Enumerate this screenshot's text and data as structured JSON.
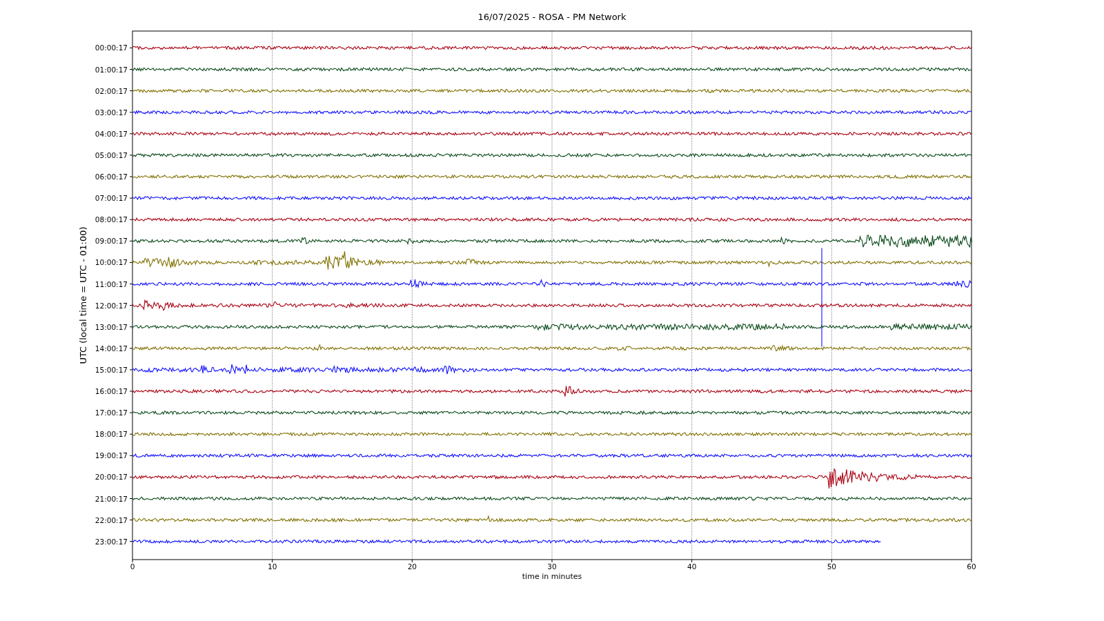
{
  "title": "16/07/2025 - ROSA - PM Network",
  "ylabel": "UTC (local time = UTC - 01:00)",
  "xlabel": "time in minutes",
  "xticks": [
    "0",
    "10",
    "20",
    "30",
    "40",
    "50",
    "60"
  ],
  "traces": [
    {
      "label": "00:00:17",
      "color": "#aa0011",
      "level": 1
    },
    {
      "label": "01:00:17",
      "color": "#0a4a1a",
      "level": 1
    },
    {
      "label": "02:00:17",
      "color": "#807000",
      "level": 1
    },
    {
      "label": "03:00:17",
      "color": "#1010ff",
      "level": 1
    },
    {
      "label": "04:00:17",
      "color": "#aa0011",
      "level": 1
    },
    {
      "label": "05:00:17",
      "color": "#0a4a1a",
      "level": 1
    },
    {
      "label": "06:00:17",
      "color": "#807000",
      "level": 1
    },
    {
      "label": "07:00:17",
      "color": "#1010ff",
      "level": 1
    },
    {
      "label": "08:00:17",
      "color": "#aa0011",
      "level": 1
    },
    {
      "label": "09:00:17",
      "color": "#0a4a1a",
      "level": 1
    },
    {
      "label": "10:00:17",
      "color": "#807000",
      "level": 1
    },
    {
      "label": "11:00:17",
      "color": "#1010ff",
      "level": 1
    },
    {
      "label": "12:00:17",
      "color": "#aa0011",
      "level": 1
    },
    {
      "label": "13:00:17",
      "color": "#0a4a1a",
      "level": 1
    },
    {
      "label": "14:00:17",
      "color": "#807000",
      "level": 1
    },
    {
      "label": "15:00:17",
      "color": "#1010ff",
      "level": 1
    },
    {
      "label": "16:00:17",
      "color": "#aa0011",
      "level": 1
    },
    {
      "label": "17:00:17",
      "color": "#0a4a1a",
      "level": 1
    },
    {
      "label": "18:00:17",
      "color": "#807000",
      "level": 1
    },
    {
      "label": "19:00:17",
      "color": "#1010ff",
      "level": 1
    },
    {
      "label": "20:00:17",
      "color": "#aa0011",
      "level": 1
    },
    {
      "label": "21:00:17",
      "color": "#0a4a1a",
      "level": 1
    },
    {
      "label": "22:00:17",
      "color": "#807000",
      "level": 1
    },
    {
      "label": "23:00:17",
      "color": "#1010ff",
      "level": 0.892
    }
  ]
}
